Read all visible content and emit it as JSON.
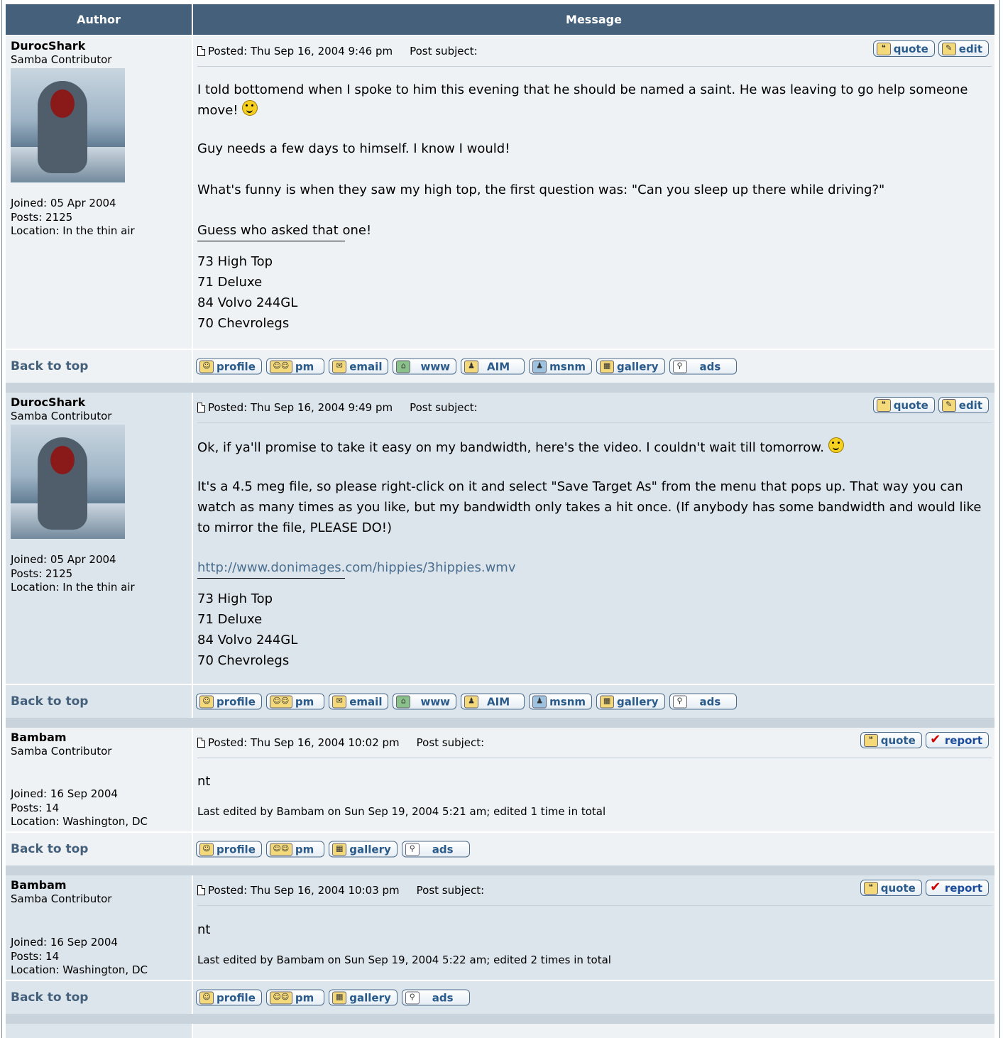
{
  "header": {
    "author": "Author",
    "message": "Message"
  },
  "common": {
    "back_to_top": "Back to top",
    "post_subject_label": "Post subject:"
  },
  "buttons": {
    "quote": "quote",
    "edit": "edit",
    "report": "report",
    "profile": "profile",
    "pm": "pm",
    "email": "email",
    "www": "www",
    "aim": "AIM",
    "msnm": "msnm",
    "gallery": "gallery",
    "ads": "ads"
  },
  "posts": [
    {
      "username": "DurocShark",
      "rank": "Samba Contributor",
      "joined": "Joined: 05 Apr 2004",
      "posts": "Posts: 2125",
      "location": "Location: In the thin air",
      "posted": "Posted: Thu Sep 16, 2004 9:46 pm",
      "paragraphs": [
        "I told bottomend when I spoke to him this evening that he should be named a saint. He was leaving to go help someone move!",
        "Guy needs a few days to himself. I know I would!",
        "What's funny is when they saw my high top, the first question was: \"Can you sleep up there while driving?\"",
        "Guess who asked that one!"
      ],
      "signature": [
        "73 High Top",
        "71 Deluxe",
        "84 Volvo 244GL",
        "70 Chevrolegs"
      ]
    },
    {
      "username": "DurocShark",
      "rank": "Samba Contributor",
      "joined": "Joined: 05 Apr 2004",
      "posts": "Posts: 2125",
      "location": "Location: In the thin air",
      "posted": "Posted: Thu Sep 16, 2004 9:49 pm",
      "paragraphs": [
        "Ok, if ya'll promise to take it easy on my bandwidth, here's the video. I couldn't wait till tomorrow.",
        "It's a 4.5 meg file, so please right-click on it and select \"Save Target As\" from the menu that pops up. That way you can watch as many times as you like, but my bandwidth only takes a hit once. (If anybody has some bandwidth and would like to mirror the file, PLEASE DO!)"
      ],
      "link": "http://www.donimages.com/hippies/3hippies.wmv",
      "signature": [
        "73 High Top",
        "71 Deluxe",
        "84 Volvo 244GL",
        "70 Chevrolegs"
      ]
    },
    {
      "username": "Bambam",
      "rank": "Samba Contributor",
      "joined": "Joined: 16 Sep 2004",
      "posts": "Posts: 14",
      "location": "Location: Washington, DC",
      "posted": "Posted: Thu Sep 16, 2004 10:02 pm",
      "text": "nt",
      "edited": "Last edited by Bambam on Sun Sep 19, 2004 5:21 am; edited 1 time in total"
    },
    {
      "username": "Bambam",
      "rank": "Samba Contributor",
      "joined": "Joined: 16 Sep 2004",
      "posts": "Posts: 14",
      "location": "Location: Washington, DC",
      "posted": "Posted: Thu Sep 16, 2004 10:03 pm",
      "text": "nt",
      "edited": "Last edited by Bambam on Sun Sep 19, 2004 5:22 am; edited 2 times in total"
    }
  ]
}
